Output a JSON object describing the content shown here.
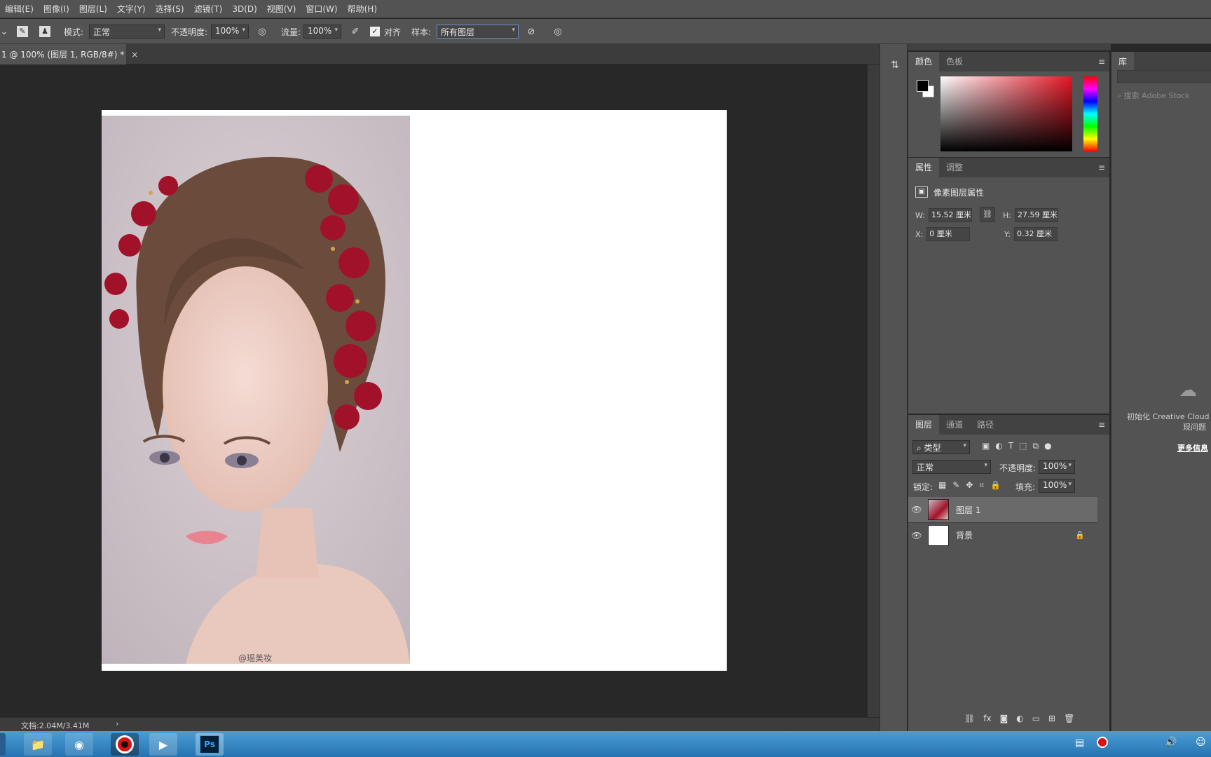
{
  "menu": [
    "编辑(E)",
    "图像(I)",
    "图层(L)",
    "文字(Y)",
    "选择(S)",
    "滤镜(T)",
    "3D(D)",
    "视图(V)",
    "窗口(W)",
    "帮助(H)"
  ],
  "options": {
    "mode_label": "模式:",
    "mode_value": "正常",
    "opacity_label": "不透明度:",
    "opacity_value": "100%",
    "flow_label": "流量:",
    "flow_value": "100%",
    "align_label": "对齐",
    "align_checked": true,
    "sample_label": "样本:",
    "sample_value": "所有图层"
  },
  "document": {
    "tab_title": "1 @ 100% (图层 1, RGB/8#) *",
    "watermark": "@瑶美妆",
    "status": "文档:2.04M/3.41M"
  },
  "color_panel": {
    "tabs": [
      "颜色",
      "色板"
    ],
    "fg": "#000000",
    "bg": "#ffffff"
  },
  "properties_panel": {
    "tabs": [
      "属性",
      "调整"
    ],
    "title": "像素图层属性",
    "w_label": "W:",
    "w_value": "15.52 厘米",
    "h_label": "H:",
    "h_value": "27.59 厘米",
    "x_label": "X:",
    "x_value": "0 厘米",
    "y_label": "Y:",
    "y_value": "0.32 厘米"
  },
  "layers_panel": {
    "tabs": [
      "图层",
      "通道",
      "路径"
    ],
    "filter_value": "类型",
    "blend_mode": "正常",
    "opacity_label": "不透明度:",
    "opacity_value": "100%",
    "lock_label": "锁定:",
    "fill_label": "填充:",
    "fill_value": "100%",
    "layers": [
      {
        "name": "图层 1",
        "selected": true
      },
      {
        "name": "背景",
        "locked": true
      }
    ]
  },
  "library_panel": {
    "tab": "库",
    "search_placeholder": "搜索 Adobe Stock",
    "message_line1": "初始化 Creative Cloud",
    "message_line2": "现问题",
    "more_info": "更多信息"
  },
  "colors": {
    "ui_panel": "#535353",
    "ui_dark": "#282828",
    "accent_red": "#e41524"
  }
}
